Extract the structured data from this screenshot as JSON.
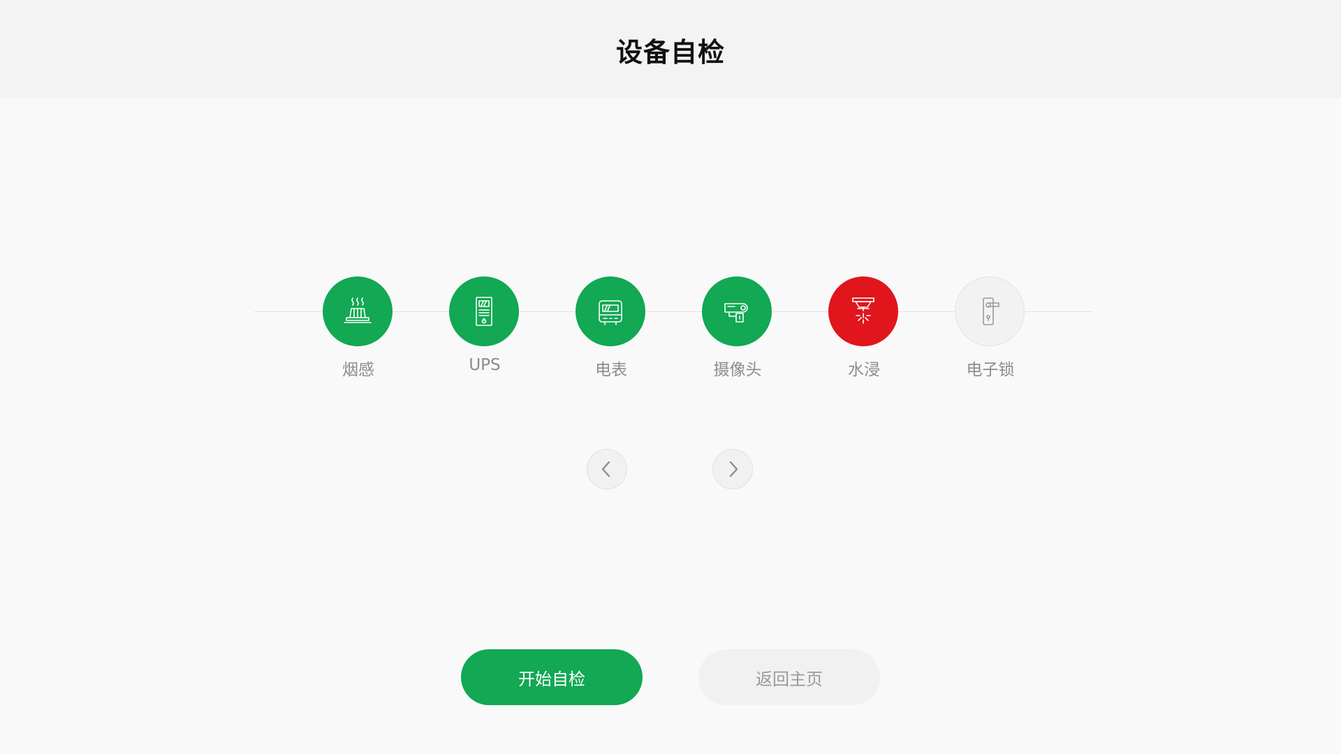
{
  "header": {
    "title": "设备自检"
  },
  "devices": [
    {
      "label": "烟感",
      "status": "ok",
      "icon": "smoke-detector-icon"
    },
    {
      "label": "UPS",
      "status": "ok",
      "icon": "ups-icon"
    },
    {
      "label": "电表",
      "status": "ok",
      "icon": "electric-meter-icon"
    },
    {
      "label": "摄像头",
      "status": "ok",
      "icon": "camera-icon"
    },
    {
      "label": "水浸",
      "status": "alarm",
      "icon": "water-sensor-icon"
    },
    {
      "label": "电子锁",
      "status": "idle",
      "icon": "door-lock-icon"
    }
  ],
  "colors": {
    "ok": "#12a854",
    "alarm": "#e0161c",
    "idle": "#f2f2f2"
  },
  "nav": {
    "prev_icon": "chevron-left-icon",
    "next_icon": "chevron-right-icon"
  },
  "actions": {
    "start_label": "开始自检",
    "home_label": "返回主页"
  }
}
